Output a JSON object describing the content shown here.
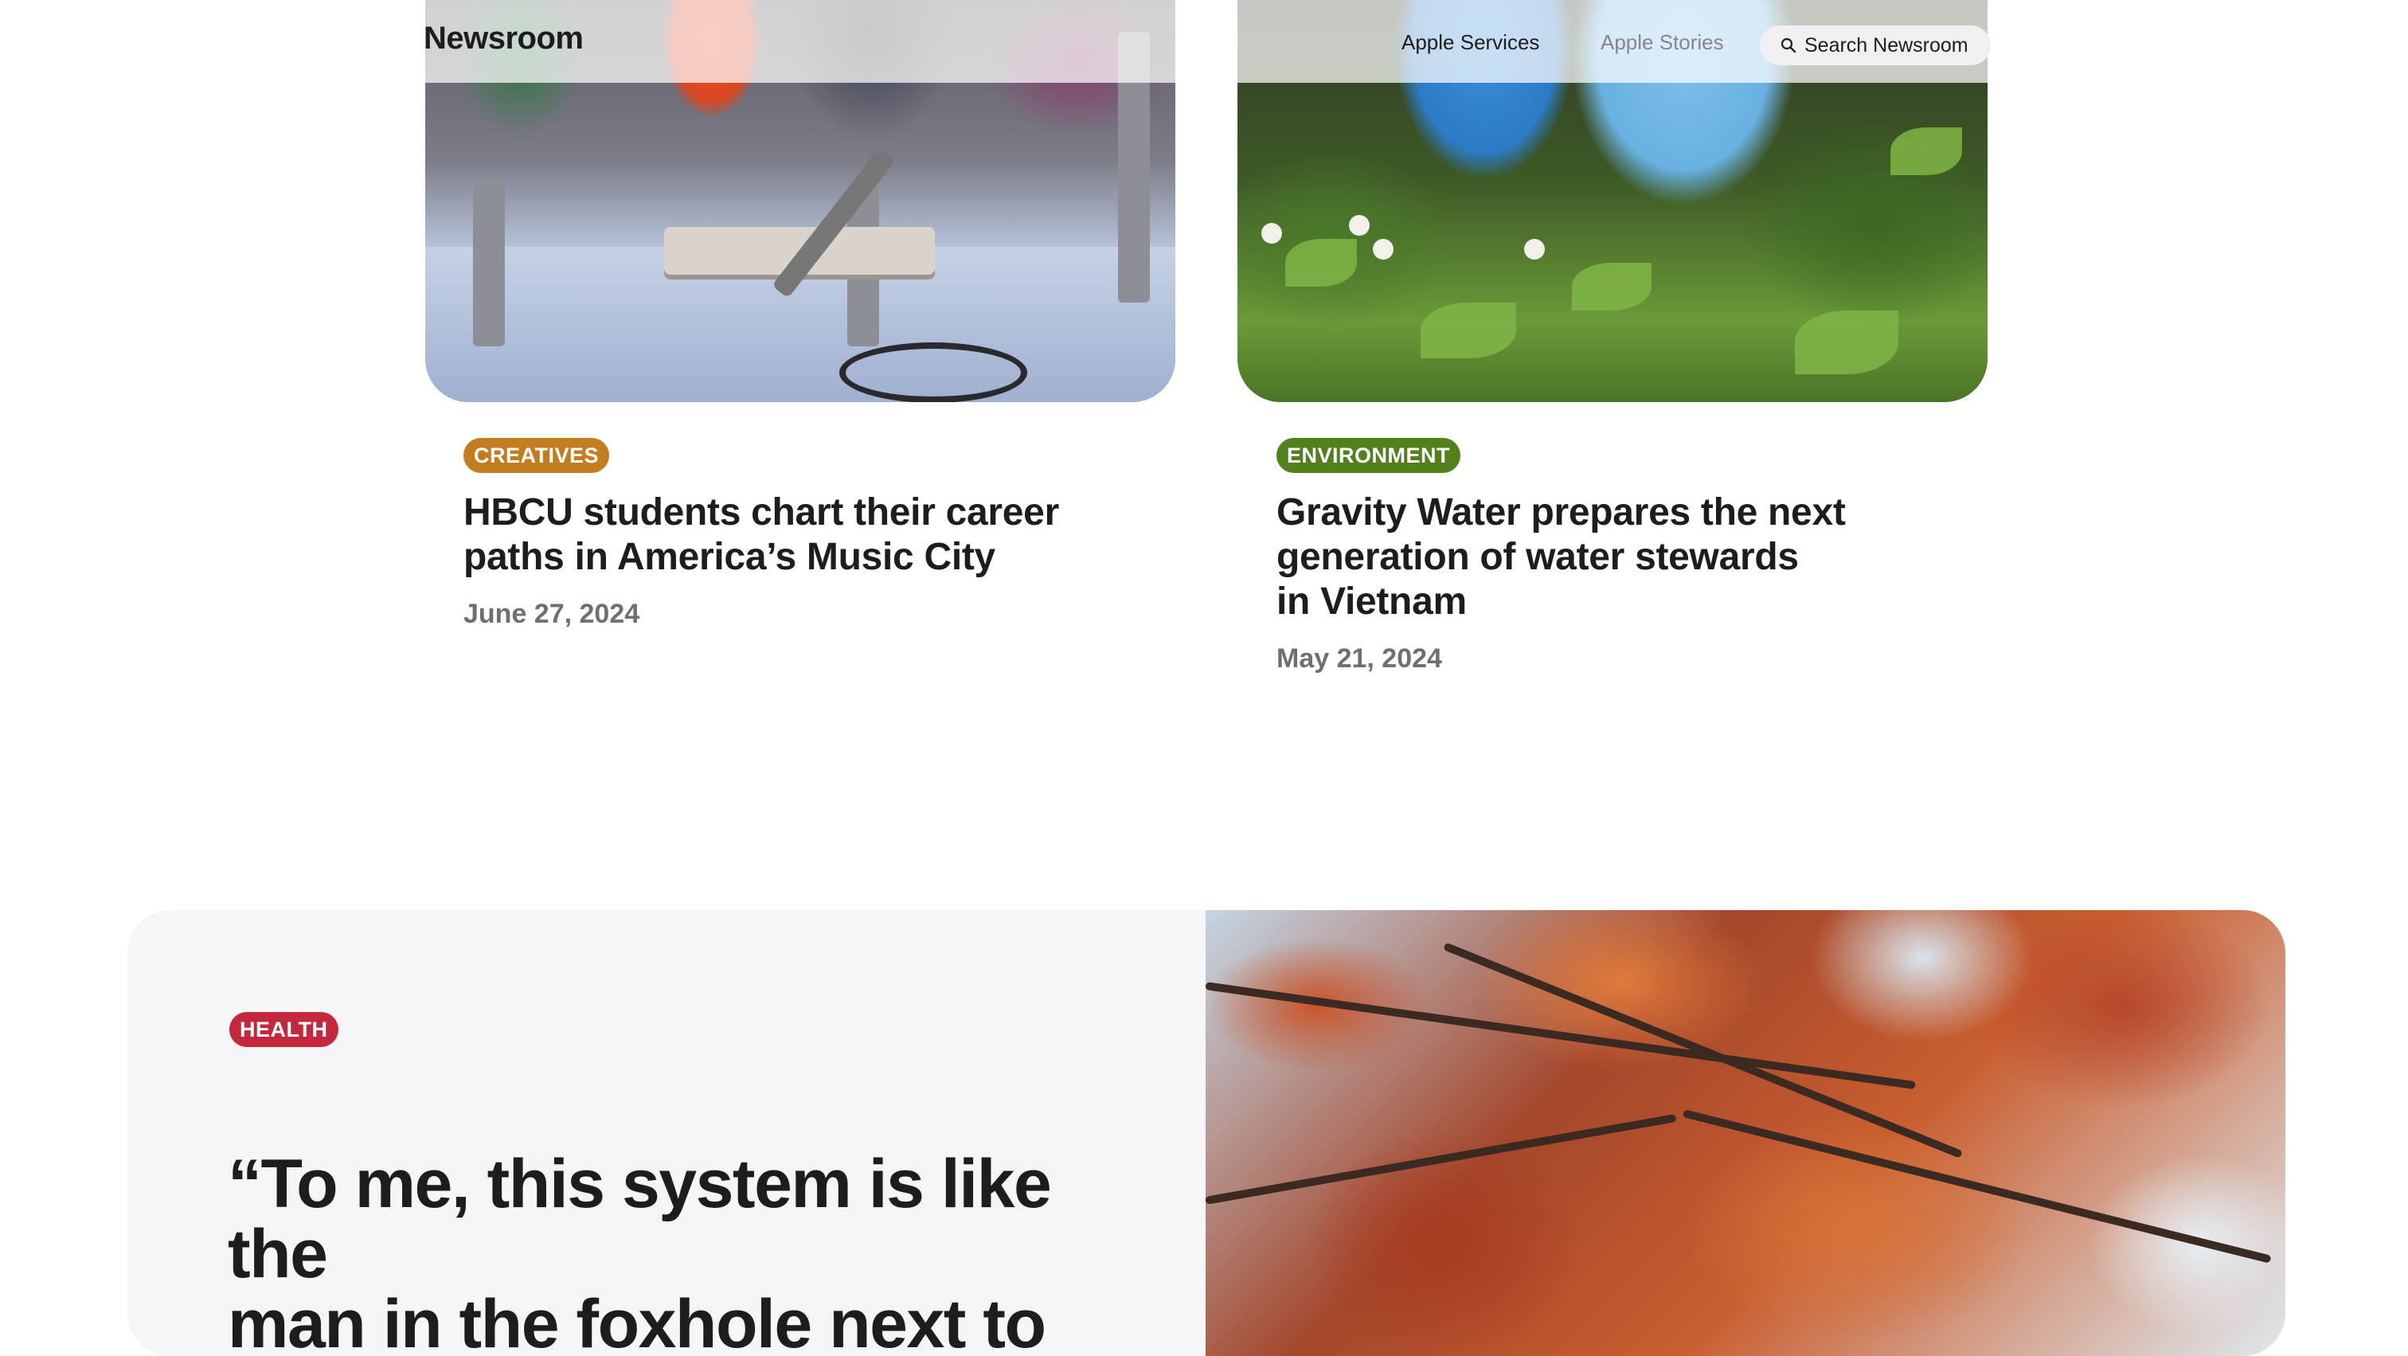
{
  "nav": {
    "brand": "Newsroom",
    "links": [
      "Apple Services",
      "Apple Stories"
    ],
    "search_label": "Search Newsroom"
  },
  "articles": [
    {
      "category": "CREATIVES",
      "category_color": "#c47d1e",
      "title_lines": [
        "HBCU students chart their career",
        "paths in America’s Music City"
      ],
      "date": "June 27, 2024"
    },
    {
      "category": "ENVIRONMENT",
      "category_color": "#52801c",
      "title_lines": [
        "Gravity Water prepares the next",
        "generation of water stewards",
        "in Vietnam"
      ],
      "date": "May 21, 2024"
    }
  ],
  "feature": {
    "category": "HEALTH",
    "category_color": "#c5283d",
    "quote_lines": [
      "“To me, this system is like the",
      "man in the foxhole next to"
    ]
  },
  "icons": {
    "search": "search-icon"
  }
}
